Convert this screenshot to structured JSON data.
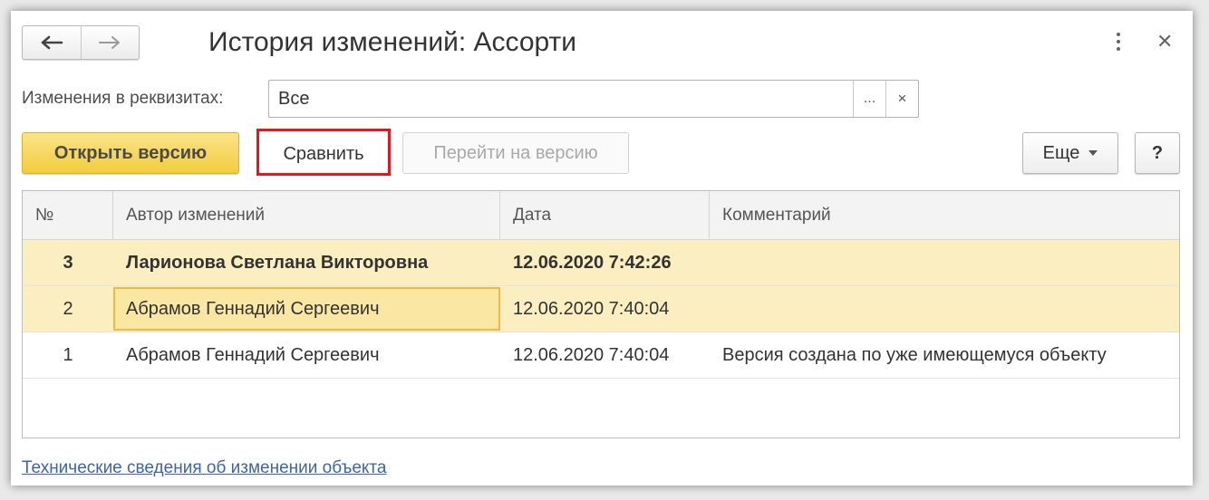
{
  "window": {
    "title": "История изменений: Ассорти"
  },
  "filter": {
    "label": "Изменения в реквизитах:",
    "value": "Все",
    "select_button": "...",
    "clear_button": "×"
  },
  "toolbar": {
    "open_version": "Открыть версию",
    "compare": "Сравнить",
    "go_to_version": "Перейти на версию",
    "more": "Еще",
    "help": "?"
  },
  "table": {
    "columns": [
      "№",
      "Автор изменений",
      "Дата",
      "Комментарий"
    ],
    "rows": [
      {
        "num": "3",
        "author": "Ларионова Светлана Викторовна",
        "date": "12.06.2020 7:42:26",
        "comment": ""
      },
      {
        "num": "2",
        "author": "Абрамов Геннадий Сергеевич",
        "date": "12.06.2020 7:40:04",
        "comment": ""
      },
      {
        "num": "1",
        "author": "Абрамов Геннадий Сергеевич",
        "date": "12.06.2020 7:40:04",
        "comment": "Версия создана по уже имеющемуся объекту"
      }
    ]
  },
  "footer": {
    "tech_link": "Технические сведения об изменении объекта"
  },
  "colors": {
    "primary_button": "#f2cd3a",
    "highlight_annotation": "#e8141b",
    "selected_row": "#fbeec0",
    "link": "#3f64a8"
  }
}
